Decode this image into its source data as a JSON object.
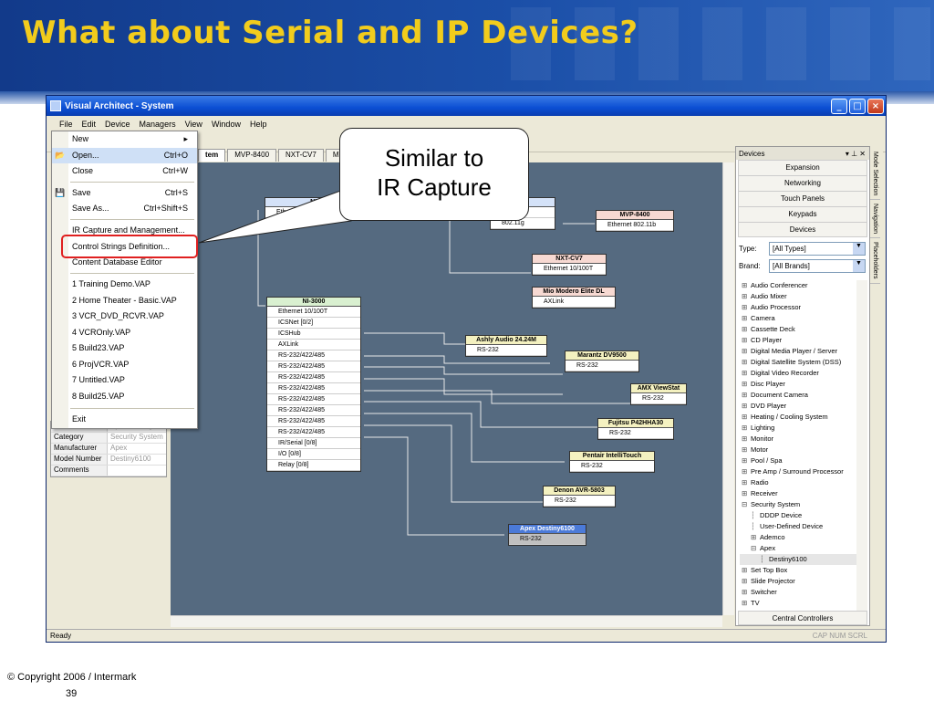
{
  "slide": {
    "title": "What about Serial and IP Devices?",
    "copyright": "© Copyright 2006 / Intermark",
    "page_number": "39"
  },
  "window": {
    "title": "Visual Architect - System",
    "buttons": [
      "_",
      "□",
      "×"
    ]
  },
  "menubar": [
    "File",
    "Edit",
    "Device",
    "Managers",
    "View",
    "Window",
    "Help"
  ],
  "file_menu": [
    {
      "label": "New",
      "shortcut": "",
      "submenu": true
    },
    {
      "label": "Open...",
      "shortcut": "Ctrl+O",
      "icon": "folder-open-icon"
    },
    {
      "label": "Close",
      "shortcut": "Ctrl+W"
    },
    {
      "label": "Save",
      "shortcut": "Ctrl+S",
      "icon": "save-icon"
    },
    {
      "label": "Save As...",
      "shortcut": "Ctrl+Shift+S"
    },
    {
      "label": "IR Capture and Management...",
      "shortcut": ""
    },
    {
      "label": "Control Strings Definition...",
      "shortcut": ""
    },
    {
      "label": "Content Database Editor",
      "shortcut": ""
    },
    {
      "label": "1 Training Demo.VAP"
    },
    {
      "label": "2 Home Theater - Basic.VAP"
    },
    {
      "label": "3 VCR_DVD_RCVR.VAP"
    },
    {
      "label": "4 VCROnly.VAP"
    },
    {
      "label": "5 Build23.VAP"
    },
    {
      "label": "6 ProjVCR.VAP"
    },
    {
      "label": "7 Untitled.VAP"
    },
    {
      "label": "8 Build25.VAP"
    },
    {
      "label": "Exit"
    }
  ],
  "callout": {
    "line1": "Similar to",
    "line2": "IR Capture"
  },
  "tabs": [
    "tem",
    "MVP-8400",
    "NXT-CV7",
    "Mio M"
  ],
  "properties": [
    {
      "key": "Name",
      "value": "Apex Destiny..."
    },
    {
      "key": "Category",
      "value": "Security System"
    },
    {
      "key": "Manufacturer",
      "value": "Apex"
    },
    {
      "key": "Model Number",
      "value": "Destiny6100"
    },
    {
      "key": "Comments",
      "value": ""
    }
  ],
  "canvas": {
    "nodes_top": [
      {
        "name": "NX",
        "rows": [
          "Ethernet 1000T [0/2]"
        ]
      },
      {
        "name": "00G",
        "rows": [
          "0/100T",
          "802.11g"
        ]
      },
      {
        "name": "MVP-8400",
        "rows": [
          "Ethernet 802.11b"
        ]
      },
      {
        "name": "NXT-CV7",
        "rows": [
          "Ethernet 10/100T"
        ]
      },
      {
        "name": "Mio Modero Elite DL",
        "rows": [
          "AXLink"
        ]
      }
    ],
    "ni3000": {
      "name": "NI-3000",
      "rows": [
        "Ethernet 10/100T",
        "ICSNet [0/2]",
        "ICSHub",
        "AXLink",
        "RS-232/422/485",
        "RS-232/422/485",
        "RS-232/422/485",
        "RS-232/422/485",
        "RS-232/422/485",
        "RS-232/422/485",
        "RS-232/422/485",
        "RS-232/422/485",
        "IR/Serial [0/8]",
        "I/O [0/8]",
        "Relay [0/8]"
      ]
    },
    "serial_devices": [
      {
        "name": "Ashly Audio 24.24M",
        "port": "RS-232"
      },
      {
        "name": "Marantz DV9500",
        "port": "RS-232"
      },
      {
        "name": "AMX ViewStat",
        "port": "RS-232"
      },
      {
        "name": "Fujitsu P42HHA30",
        "port": "RS-232"
      },
      {
        "name": "Pentair IntelliTouch",
        "port": "RS-232"
      },
      {
        "name": "Denon AVR-5803",
        "port": "RS-232"
      },
      {
        "name": "Apex Destiny6100",
        "port": "RS-232"
      }
    ]
  },
  "devices_panel": {
    "title": "Devices",
    "categories": [
      "Expansion",
      "Networking",
      "Touch Panels",
      "Keypads",
      "Devices"
    ],
    "type_label": "Type:",
    "type_value": "[All Types]",
    "brand_label": "Brand:",
    "brand_value": "[All Brands]",
    "tree": [
      {
        "label": "Audio Conferencer",
        "level": 0,
        "expander": "+"
      },
      {
        "label": "Audio Mixer",
        "level": 0,
        "expander": "+"
      },
      {
        "label": "Audio Processor",
        "level": 0,
        "expander": "+"
      },
      {
        "label": "Camera",
        "level": 0,
        "expander": "+"
      },
      {
        "label": "Cassette Deck",
        "level": 0,
        "expander": "+"
      },
      {
        "label": "CD Player",
        "level": 0,
        "expander": "+"
      },
      {
        "label": "Digital Media Player / Server",
        "level": 0,
        "expander": "+"
      },
      {
        "label": "Digital Satellite System (DSS)",
        "level": 0,
        "expander": "+"
      },
      {
        "label": "Digital Video Recorder",
        "level": 0,
        "expander": "+"
      },
      {
        "label": "Disc Player",
        "level": 0,
        "expander": "+"
      },
      {
        "label": "Document Camera",
        "level": 0,
        "expander": "+"
      },
      {
        "label": "DVD Player",
        "level": 0,
        "expander": "+"
      },
      {
        "label": "Heating / Cooling System",
        "level": 0,
        "expander": "+"
      },
      {
        "label": "Lighting",
        "level": 0,
        "expander": "+"
      },
      {
        "label": "Monitor",
        "level": 0,
        "expander": "+"
      },
      {
        "label": "Motor",
        "level": 0,
        "expander": "+"
      },
      {
        "label": "Pool / Spa",
        "level": 0,
        "expander": "+"
      },
      {
        "label": "Pre Amp / Surround Processor",
        "level": 0,
        "expander": "+"
      },
      {
        "label": "Radio",
        "level": 0,
        "expander": "+"
      },
      {
        "label": "Receiver",
        "level": 0,
        "expander": "+"
      },
      {
        "label": "Security System",
        "level": 0,
        "expander": "−"
      },
      {
        "label": "DDDP Device",
        "level": 1,
        "expander": ""
      },
      {
        "label": "User-Defined Device",
        "level": 1,
        "expander": ""
      },
      {
        "label": "Ademco",
        "level": 1,
        "expander": "+"
      },
      {
        "label": "Apex",
        "level": 1,
        "expander": "−"
      },
      {
        "label": "Destiny6100",
        "level": 2,
        "expander": "",
        "selected": true
      },
      {
        "label": "Set Top Box",
        "level": 0,
        "expander": "+"
      },
      {
        "label": "Slide Projector",
        "level": 0,
        "expander": "+"
      },
      {
        "label": "Switcher",
        "level": 0,
        "expander": "+"
      },
      {
        "label": "TV",
        "level": 0,
        "expander": "+"
      }
    ],
    "bottom_button": "Central Controllers"
  },
  "side_tabs": [
    "Mode Selection",
    "Navigation",
    "Placeholders"
  ],
  "status": {
    "left": "Ready",
    "right": "CAP  NUM  SCRL"
  },
  "colors": {
    "title": "#f2cc1c",
    "band": "#1b4fa8",
    "canvas": "#556a80",
    "highlight": "#e02020"
  }
}
